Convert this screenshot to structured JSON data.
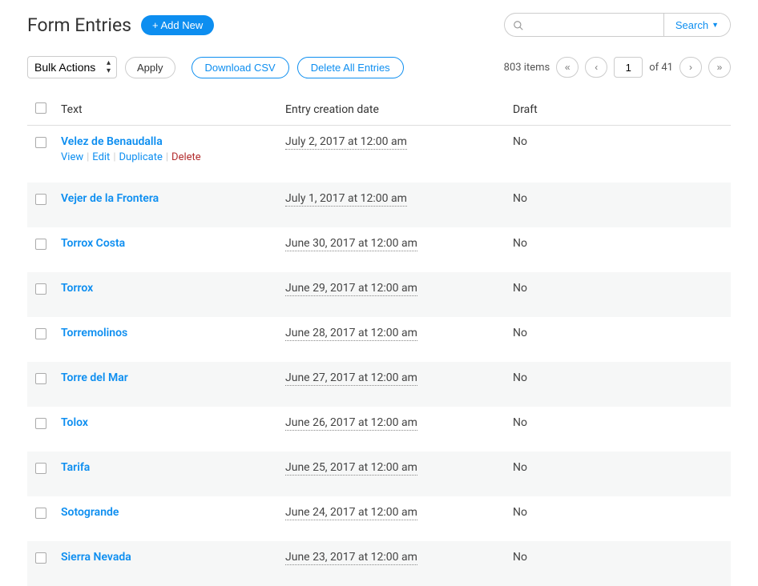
{
  "header": {
    "title": "Form Entries",
    "add_new_label": "+ Add New"
  },
  "search": {
    "placeholder": "",
    "button_label": "Search"
  },
  "toolbar": {
    "bulk_label": "Bulk Actions",
    "apply_label": "Apply",
    "download_csv_label": "Download CSV",
    "delete_all_label": "Delete All Entries"
  },
  "pagination": {
    "items_text": "803 items",
    "current_page": "1",
    "of_text": "of 41",
    "first": "«",
    "prev": "‹",
    "next": "›",
    "last": "»"
  },
  "columns": {
    "text": "Text",
    "date": "Entry creation date",
    "draft": "Draft"
  },
  "row_actions": {
    "view": "View",
    "edit": "Edit",
    "duplicate": "Duplicate",
    "delete": "Delete"
  },
  "rows": [
    {
      "text": "Velez de Benaudalla",
      "date": "July 2, 2017 at 12:00 am",
      "draft": "No",
      "show_actions": true
    },
    {
      "text": "Vejer de la Frontera",
      "date": "July 1, 2017 at 12:00 am",
      "draft": "No",
      "show_actions": false
    },
    {
      "text": "Torrox Costa",
      "date": "June 30, 2017 at 12:00 am",
      "draft": "No",
      "show_actions": false
    },
    {
      "text": "Torrox",
      "date": "June 29, 2017 at 12:00 am",
      "draft": "No",
      "show_actions": false
    },
    {
      "text": "Torremolinos",
      "date": "June 28, 2017 at 12:00 am",
      "draft": "No",
      "show_actions": false
    },
    {
      "text": "Torre del Mar",
      "date": "June 27, 2017 at 12:00 am",
      "draft": "No",
      "show_actions": false
    },
    {
      "text": "Tolox",
      "date": "June 26, 2017 at 12:00 am",
      "draft": "No",
      "show_actions": false
    },
    {
      "text": "Tarifa",
      "date": "June 25, 2017 at 12:00 am",
      "draft": "No",
      "show_actions": false
    },
    {
      "text": "Sotogrande",
      "date": "June 24, 2017 at 12:00 am",
      "draft": "No",
      "show_actions": false
    },
    {
      "text": "Sierra Nevada",
      "date": "June 23, 2017 at 12:00 am",
      "draft": "No",
      "show_actions": false
    }
  ]
}
